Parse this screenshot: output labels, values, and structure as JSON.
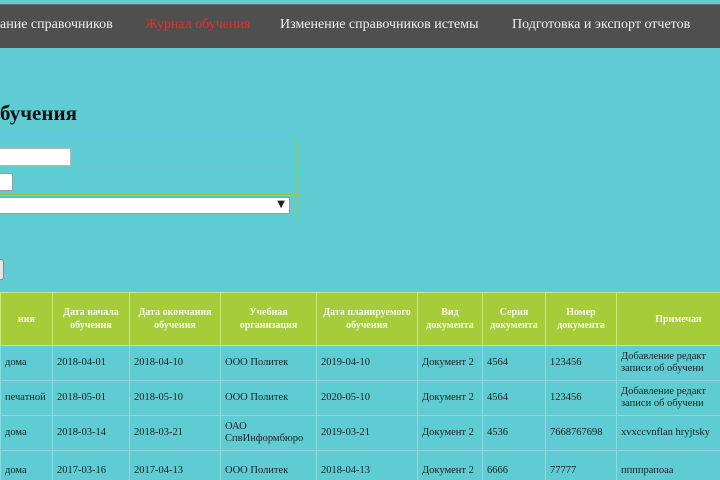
{
  "nav": {
    "items": [
      {
        "label": "ание справочников",
        "active": false
      },
      {
        "label": "Журнал обучения",
        "active": true
      },
      {
        "label": "Изменение справочников истемы",
        "active": false
      },
      {
        "label": "Подготовка и экспорт отчетов",
        "active": false
      }
    ]
  },
  "page": {
    "title": "бучения"
  },
  "filters": {
    "text_value": "",
    "checked": false,
    "select_value": ""
  },
  "table": {
    "headers": [
      "ния",
      "Дата начала обучения",
      "Дата окончания обучения",
      "Учебная организация",
      "Дата планируемого обучения",
      "Вид документа",
      "Серия документа",
      "Номер документа",
      "Примечан"
    ],
    "rows": [
      [
        "дома",
        "2018-04-01",
        "2018-04-10",
        "ООО Политек",
        "2019-04-10",
        "Документ 2",
        "4564",
        "123456",
        "Добавление редакт записи об обучени"
      ],
      [
        "печатной",
        "2018-05-01",
        "2018-05-10",
        "ООО Политек",
        "2020-05-10",
        "Документ 2",
        "4564",
        "123456",
        "Добавление редакт записи об обучени"
      ],
      [
        "дома",
        "2018-03-14",
        "2018-03-21",
        "ОАО СпвИнформбюро",
        "2019-03-21",
        "Документ 2",
        "4536",
        "7668767698",
        "xvxccvnflan hryjtsky"
      ],
      [
        "дома",
        "2017-03-16",
        "2017-04-13",
        "ООО Политек",
        "2018-04-13",
        "Документ 2",
        "6666",
        "77777",
        "ппппрапоаа"
      ]
    ]
  }
}
